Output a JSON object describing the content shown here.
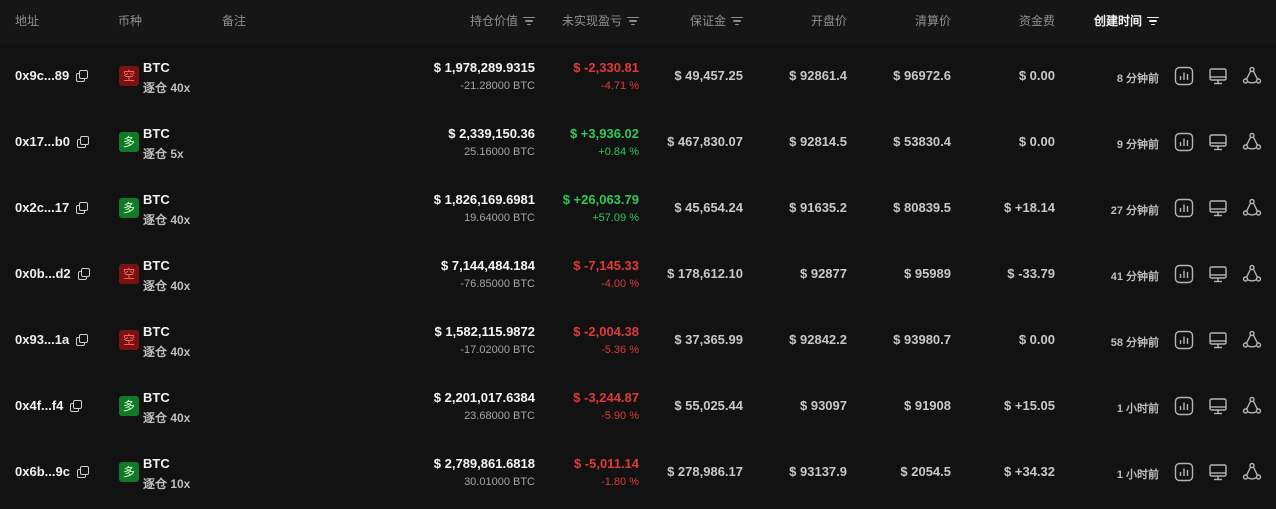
{
  "headers": {
    "address": "地址",
    "coin": "币种",
    "note": "备注",
    "position_value": "持仓价值",
    "unrealized_pnl": "未实现盈亏",
    "margin": "保证金",
    "open_price": "开盘价",
    "liq_price": "清算价",
    "funding": "资金费",
    "created_time": "创建时间"
  },
  "colors": {
    "loss": "#e03a3a",
    "profit": "#2fc95a",
    "short_badge": "#7a1212",
    "long_badge": "#127a26"
  },
  "rows": [
    {
      "address": "0x9c...89",
      "side": "short",
      "side_label": "空",
      "coin": "BTC",
      "leverage": "逐仓 40x",
      "value": "$ 1,978,289.9315",
      "qty": "-21.28000 BTC",
      "pnl": "$ -2,330.81",
      "pnl_pct": "-4.71 %",
      "pnl_sign": "neg",
      "margin": "$ 49,457.25",
      "open": "$ 92861.4",
      "liq": "$ 96972.6",
      "funding": "$ 0.00",
      "funding_sign": "neu",
      "time": "8 分钟前"
    },
    {
      "address": "0x17...b0",
      "side": "long",
      "side_label": "多",
      "coin": "BTC",
      "leverage": "逐仓 5x",
      "value": "$ 2,339,150.36",
      "qty": "25.16000 BTC",
      "pnl": "$ +3,936.02",
      "pnl_pct": "+0.84 %",
      "pnl_sign": "pos",
      "margin": "$ 467,830.07",
      "open": "$ 92814.5",
      "liq": "$ 53830.4",
      "funding": "$ 0.00",
      "funding_sign": "neu",
      "time": "9 分钟前"
    },
    {
      "address": "0x2c...17",
      "side": "long",
      "side_label": "多",
      "coin": "BTC",
      "leverage": "逐仓 40x",
      "value": "$ 1,826,169.6981",
      "qty": "19.64000 BTC",
      "pnl": "$ +26,063.79",
      "pnl_pct": "+57.09 %",
      "pnl_sign": "pos",
      "margin": "$ 45,654.24",
      "open": "$ 91635.2",
      "liq": "$ 80839.5",
      "funding": "$ +18.14",
      "funding_sign": "pos",
      "time": "27 分钟前"
    },
    {
      "address": "0x0b...d2",
      "side": "short",
      "side_label": "空",
      "coin": "BTC",
      "leverage": "逐仓 40x",
      "value": "$ 7,144,484.184",
      "qty": "-76.85000 BTC",
      "pnl": "$ -7,145.33",
      "pnl_pct": "-4.00 %",
      "pnl_sign": "neg",
      "margin": "$ 178,612.10",
      "open": "$ 92877",
      "liq": "$ 95989",
      "funding": "$ -33.79",
      "funding_sign": "neg",
      "time": "41 分钟前"
    },
    {
      "address": "0x93...1a",
      "side": "short",
      "side_label": "空",
      "coin": "BTC",
      "leverage": "逐仓 40x",
      "value": "$ 1,582,115.9872",
      "qty": "-17.02000 BTC",
      "pnl": "$ -2,004.38",
      "pnl_pct": "-5.36 %",
      "pnl_sign": "neg",
      "margin": "$ 37,365.99",
      "open": "$ 92842.2",
      "liq": "$ 93980.7",
      "funding": "$ 0.00",
      "funding_sign": "neu",
      "time": "58 分钟前"
    },
    {
      "address": "0x4f...f4",
      "side": "long",
      "side_label": "多",
      "coin": "BTC",
      "leverage": "逐仓 40x",
      "value": "$ 2,201,017.6384",
      "qty": "23.68000 BTC",
      "pnl": "$ -3,244.87",
      "pnl_pct": "-5.90 %",
      "pnl_sign": "neg",
      "margin": "$ 55,025.44",
      "open": "$ 93097",
      "liq": "$ 91908",
      "funding": "$ +15.05",
      "funding_sign": "pos",
      "time": "1 小时前"
    },
    {
      "address": "0x6b...9c",
      "side": "long",
      "side_label": "多",
      "coin": "BTC",
      "leverage": "逐仓 10x",
      "value": "$ 2,789,861.6818",
      "qty": "30.01000 BTC",
      "pnl": "$ -5,011.14",
      "pnl_pct": "-1.80 %",
      "pnl_sign": "neg",
      "margin": "$ 278,986.17",
      "open": "$ 93137.9",
      "liq": "$ 2054.5",
      "funding": "$ +34.32",
      "funding_sign": "pos",
      "time": "1 小时前"
    }
  ],
  "row_icons": [
    "chart-bars-icon",
    "monitor-icon",
    "share-nodes-icon"
  ]
}
